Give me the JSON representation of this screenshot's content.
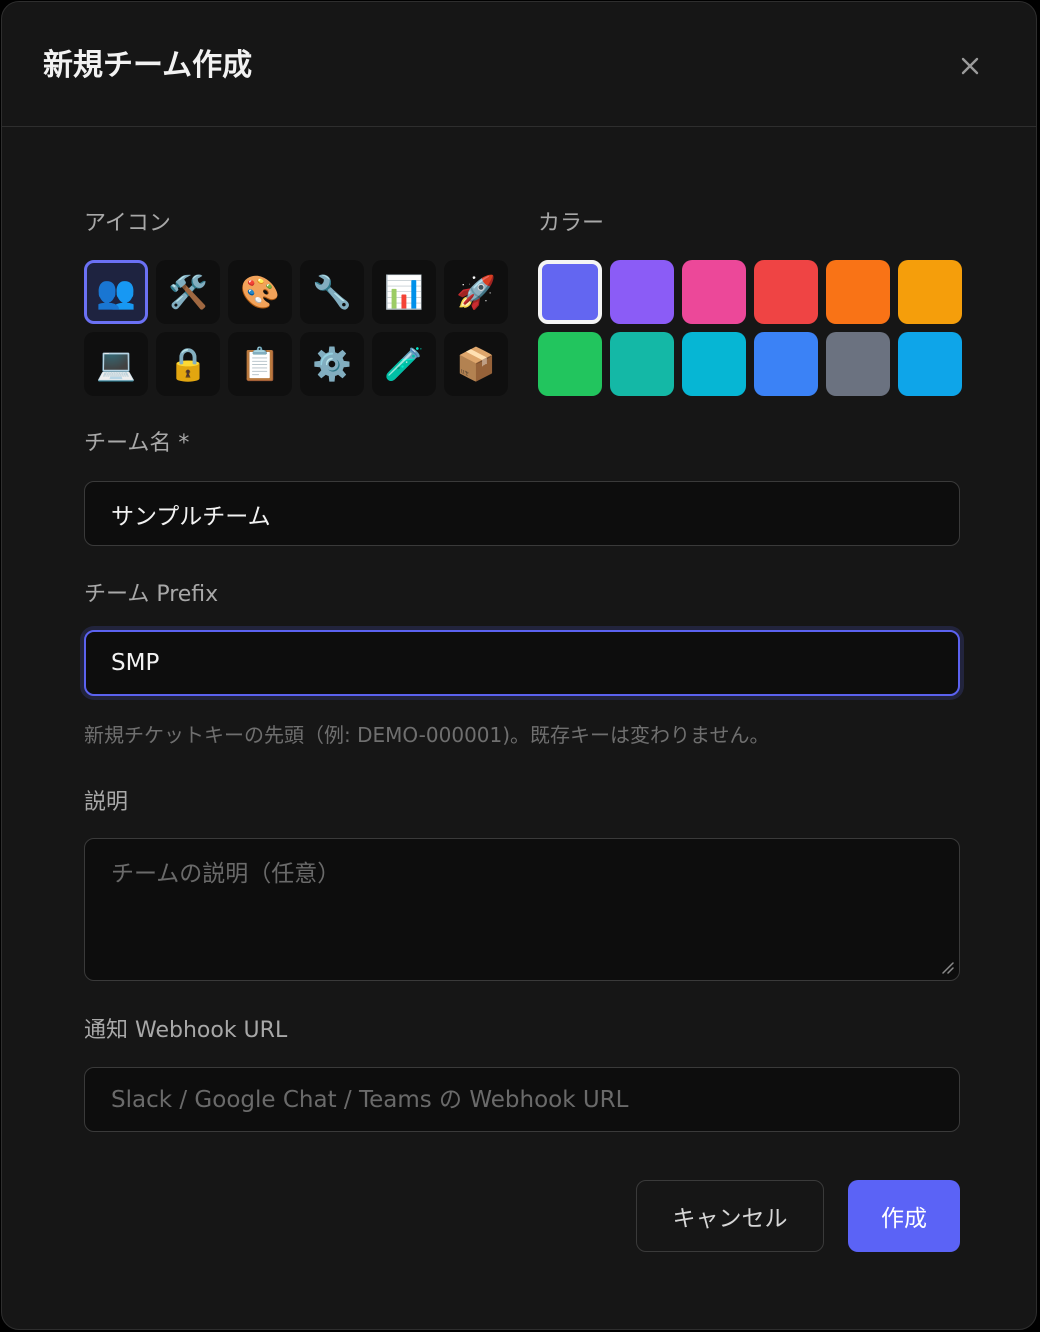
{
  "dialog": {
    "title": "新規チーム作成",
    "close_label": "×"
  },
  "icon_section": {
    "label": "アイコン",
    "selected_index": 0,
    "items": [
      {
        "glyph": "👥",
        "name": "people-icon"
      },
      {
        "glyph": "🛠️",
        "name": "tools-icon"
      },
      {
        "glyph": "🎨",
        "name": "palette-icon"
      },
      {
        "glyph": "🔧",
        "name": "wrench-icon"
      },
      {
        "glyph": "📊",
        "name": "bar-chart-icon"
      },
      {
        "glyph": "🚀",
        "name": "rocket-icon"
      },
      {
        "glyph": "💻",
        "name": "laptop-icon"
      },
      {
        "glyph": "🔒",
        "name": "lock-icon"
      },
      {
        "glyph": "📋",
        "name": "clipboard-icon"
      },
      {
        "glyph": "⚙️",
        "name": "gear-icon"
      },
      {
        "glyph": "🧪",
        "name": "test-tube-icon"
      },
      {
        "glyph": "📦",
        "name": "package-icon"
      }
    ]
  },
  "color_section": {
    "label": "カラー",
    "selected_index": 0,
    "swatches": [
      "#6366f1",
      "#8b5cf6",
      "#ec4899",
      "#ef4444",
      "#f97316",
      "#f59e0b",
      "#22c55e",
      "#14b8a6",
      "#06b6d4",
      "#3b82f6",
      "#6b7280",
      "#0ea5e9"
    ]
  },
  "team_name": {
    "label": "チーム名 *",
    "value": "サンプルチーム"
  },
  "team_prefix": {
    "label": "チーム Prefix",
    "value": "SMP",
    "hint": "新規チケットキーの先頭（例: DEMO-000001)。既存キーは変わりません。"
  },
  "description": {
    "label": "説明",
    "placeholder": "チームの説明（任意）",
    "value": ""
  },
  "webhook": {
    "label": "通知 Webhook URL",
    "placeholder": "Slack / Google Chat / Teams の Webhook URL",
    "value": ""
  },
  "actions": {
    "cancel_label": "キャンセル",
    "create_label": "作成"
  }
}
